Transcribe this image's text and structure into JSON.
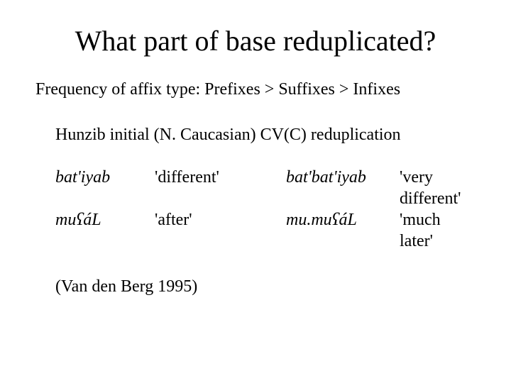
{
  "title": "What part of base reduplicated?",
  "freq_line": "Frequency of affix type: Prefixes > Suffixes > Infixes",
  "language_line": "Hunzib initial (N. Caucasian) CV(C) reduplication",
  "examples": [
    {
      "base": "bat'iyab",
      "gloss": "'different'",
      "redup": "bat'bat'iyab",
      "redup_gloss": "'very different'"
    },
    {
      "base": "muʕáL",
      "gloss": "'after'",
      "redup": "mu.muʕáL",
      "redup_gloss": "'much later'"
    }
  ],
  "citation": "(Van den Berg 1995)"
}
